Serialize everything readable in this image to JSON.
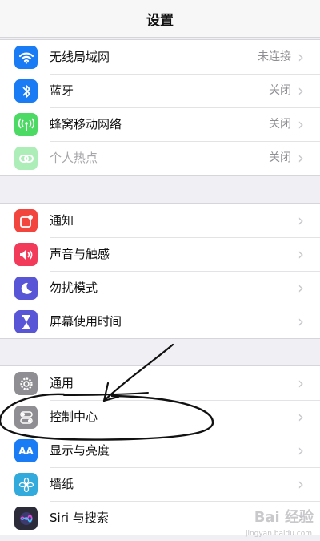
{
  "nav": {
    "title": "设置"
  },
  "group1": [
    {
      "label": "无线局域网",
      "value": "未连接",
      "icon": "wifi-icon",
      "color": "#1a7cf5"
    },
    {
      "label": "蓝牙",
      "value": "关闭",
      "icon": "bluetooth-icon",
      "color": "#1a7cf5"
    },
    {
      "label": "蜂窝移动网络",
      "value": "关闭",
      "icon": "cellular-antenna-icon",
      "color": "#4cd964"
    },
    {
      "label": "个人热点",
      "value": "关闭",
      "icon": "hotspot-link-icon",
      "color": "#4cd964"
    }
  ],
  "group2": [
    {
      "label": "通知",
      "icon": "notification-icon",
      "color": "#f2453d"
    },
    {
      "label": "声音与触感",
      "icon": "speaker-icon",
      "color": "#f23b5a"
    },
    {
      "label": "勿扰模式",
      "icon": "moon-icon",
      "color": "#5856d6"
    },
    {
      "label": "屏幕使用时间",
      "icon": "hourglass-icon",
      "color": "#5856d6"
    }
  ],
  "group3": [
    {
      "label": "通用",
      "icon": "gear-icon",
      "color": "#8e8e93"
    },
    {
      "label": "控制中心",
      "icon": "toggle-switches-icon",
      "color": "#8e8e93"
    },
    {
      "label": "显示与亮度",
      "icon": "text-size-icon",
      "color": "#1a7cf5"
    },
    {
      "label": "墙纸",
      "icon": "wallpaper-flower-icon",
      "color": "#32aadc"
    },
    {
      "label": "Siri 与搜索",
      "icon": "siri-icon",
      "color": "#2b2b3a"
    }
  ],
  "chevron": "›",
  "icon_text": {
    "display": "AA"
  },
  "watermark": {
    "text": "Bai 经验",
    "url": "jingyan.baidu.com"
  }
}
